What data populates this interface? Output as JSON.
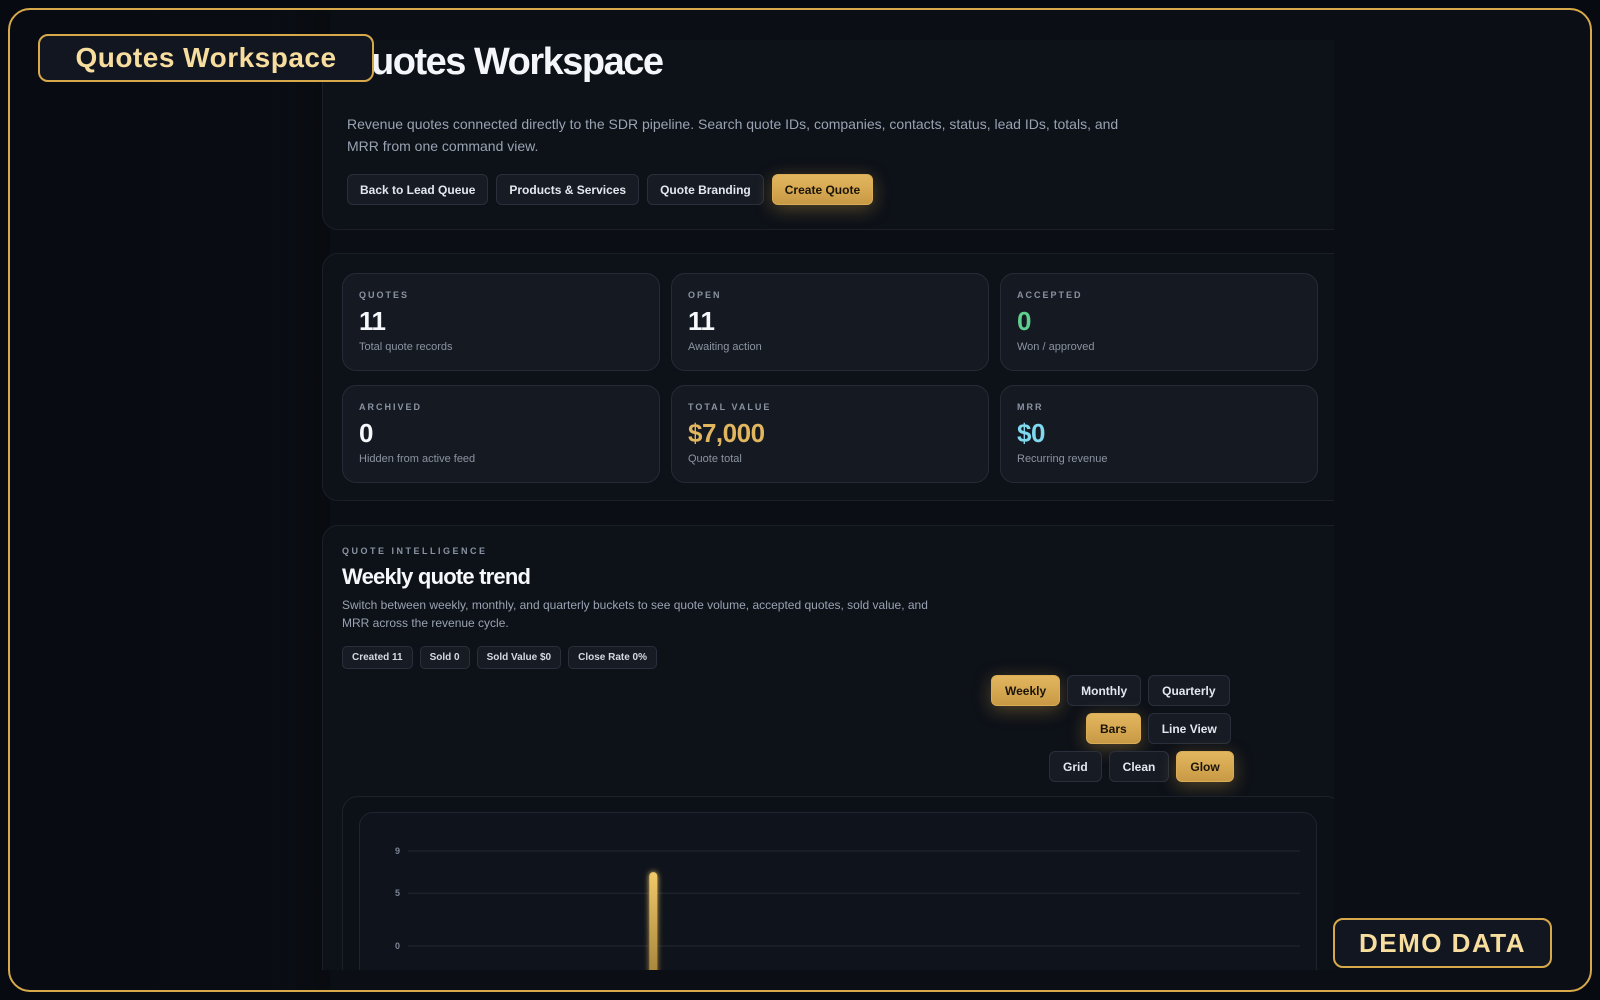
{
  "overlay": {
    "title_badge": "Quotes Workspace",
    "demo_badge": "DEMO DATA"
  },
  "hero": {
    "title": "Quotes Workspace",
    "description": "Revenue quotes connected directly to the SDR pipeline. Search quote IDs, companies, contacts, status, lead IDs, totals, and MRR from one command view.",
    "buttons": {
      "back": "Back to Lead Queue",
      "products": "Products & Services",
      "branding": "Quote Branding",
      "create": "Create Quote"
    }
  },
  "stats": [
    {
      "label": "QUOTES",
      "value": "11",
      "sub": "Total quote records",
      "color": "#f6f8fb"
    },
    {
      "label": "OPEN",
      "value": "11",
      "sub": "Awaiting action",
      "color": "#f6f8fb"
    },
    {
      "label": "ACCEPTED",
      "value": "0",
      "sub": "Won / approved",
      "color": "#5fcf8f"
    },
    {
      "label": "ARCHIVED",
      "value": "0",
      "sub": "Hidden from active feed",
      "color": "#f6f8fb"
    },
    {
      "label": "TOTAL VALUE",
      "value": "$7,000",
      "sub": "Quote total",
      "color": "#e2b65e"
    },
    {
      "label": "MRR",
      "value": "$0",
      "sub": "Recurring revenue",
      "color": "#7fd8ee"
    }
  ],
  "intel": {
    "kicker": "QUOTE INTELLIGENCE",
    "title": "Weekly quote trend",
    "description": "Switch between weekly, monthly, and quarterly buckets to see quote volume, accepted quotes, sold value, and MRR across the revenue cycle.",
    "chips": {
      "created": "Created 11",
      "sold": "Sold 0",
      "sold_value": "Sold Value $0",
      "close_rate": "Close Rate 0%"
    },
    "period": {
      "weekly": "Weekly",
      "monthly": "Monthly",
      "quarterly": "Quarterly",
      "selected": "Weekly"
    },
    "view": {
      "bars": "Bars",
      "line": "Line View",
      "selected": "Bars"
    },
    "style": {
      "grid": "Grid",
      "clean": "Clean",
      "glow": "Glow",
      "selected": "Glow"
    }
  },
  "chart_data": {
    "type": "bar",
    "ylim": [
      0,
      9
    ],
    "yticks": [
      0,
      5,
      9
    ],
    "series": [
      {
        "values": [
          0,
          0,
          0,
          0,
          0,
          7,
          0,
          0,
          0,
          0,
          0,
          0,
          0,
          0,
          0,
          0,
          0,
          0,
          0,
          0
        ]
      }
    ],
    "bar_color": "#e2b65e",
    "grid": true
  },
  "colors": {
    "accent": "#d7a94b",
    "background": "#070a10",
    "panel": "#0d1118"
  }
}
